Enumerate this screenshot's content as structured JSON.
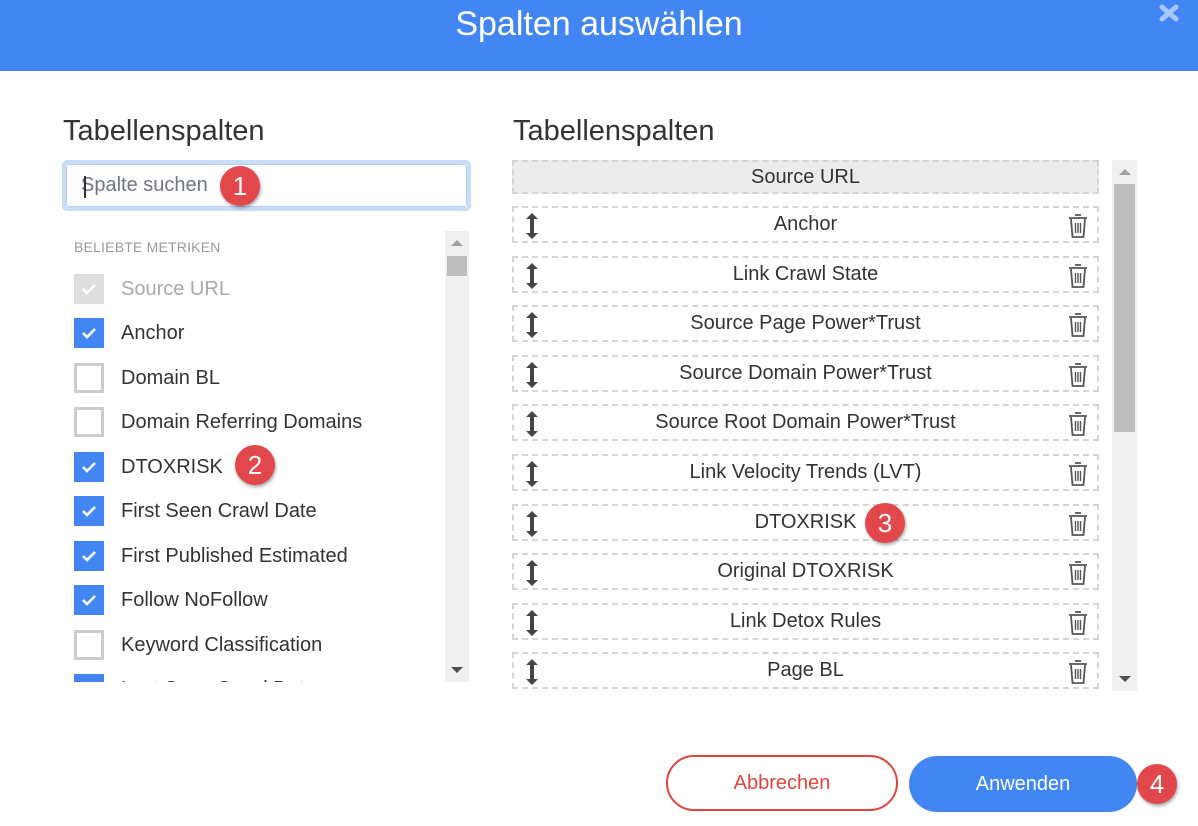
{
  "header": {
    "title": "Spalten auswählen",
    "close_icon": "close-x-icon"
  },
  "left_panel": {
    "title": "Tabellenspalten",
    "search": {
      "placeholder": "Spalte suchen",
      "value": ""
    },
    "group_label": "BELIEBTE METRIKEN",
    "items": [
      {
        "label": "Source URL",
        "state": "disabled-checked"
      },
      {
        "label": "Anchor",
        "state": "checked"
      },
      {
        "label": "Domain BL",
        "state": "unchecked"
      },
      {
        "label": "Domain Referring Domains",
        "state": "unchecked"
      },
      {
        "label": "DTOXRISK",
        "state": "checked"
      },
      {
        "label": "First Seen Crawl Date",
        "state": "checked"
      },
      {
        "label": "First Published Estimated",
        "state": "checked"
      },
      {
        "label": "Follow NoFollow",
        "state": "checked"
      },
      {
        "label": "Keyword Classification",
        "state": "unchecked"
      },
      {
        "label": "Last Seen Crawl Date",
        "state": "checked"
      }
    ]
  },
  "right_panel": {
    "title": "Tabellenspalten",
    "fixed_column": "Source URL",
    "columns": [
      "Anchor",
      "Link Crawl State",
      "Source Page Power*Trust",
      "Source Domain Power*Trust",
      "Source Root Domain Power*Trust",
      "Link Velocity Trends (LVT)",
      "DTOXRISK",
      "Original DTOXRISK",
      "Link Detox Rules",
      "Page BL"
    ]
  },
  "annotations": {
    "one": "1",
    "two": "2",
    "three": "3",
    "four": "4"
  },
  "footer": {
    "cancel_label": "Abbrechen",
    "apply_label": "Anwenden"
  },
  "colors": {
    "primary": "#4286f4",
    "danger": "#e0443e",
    "badge": "#e2474b"
  }
}
